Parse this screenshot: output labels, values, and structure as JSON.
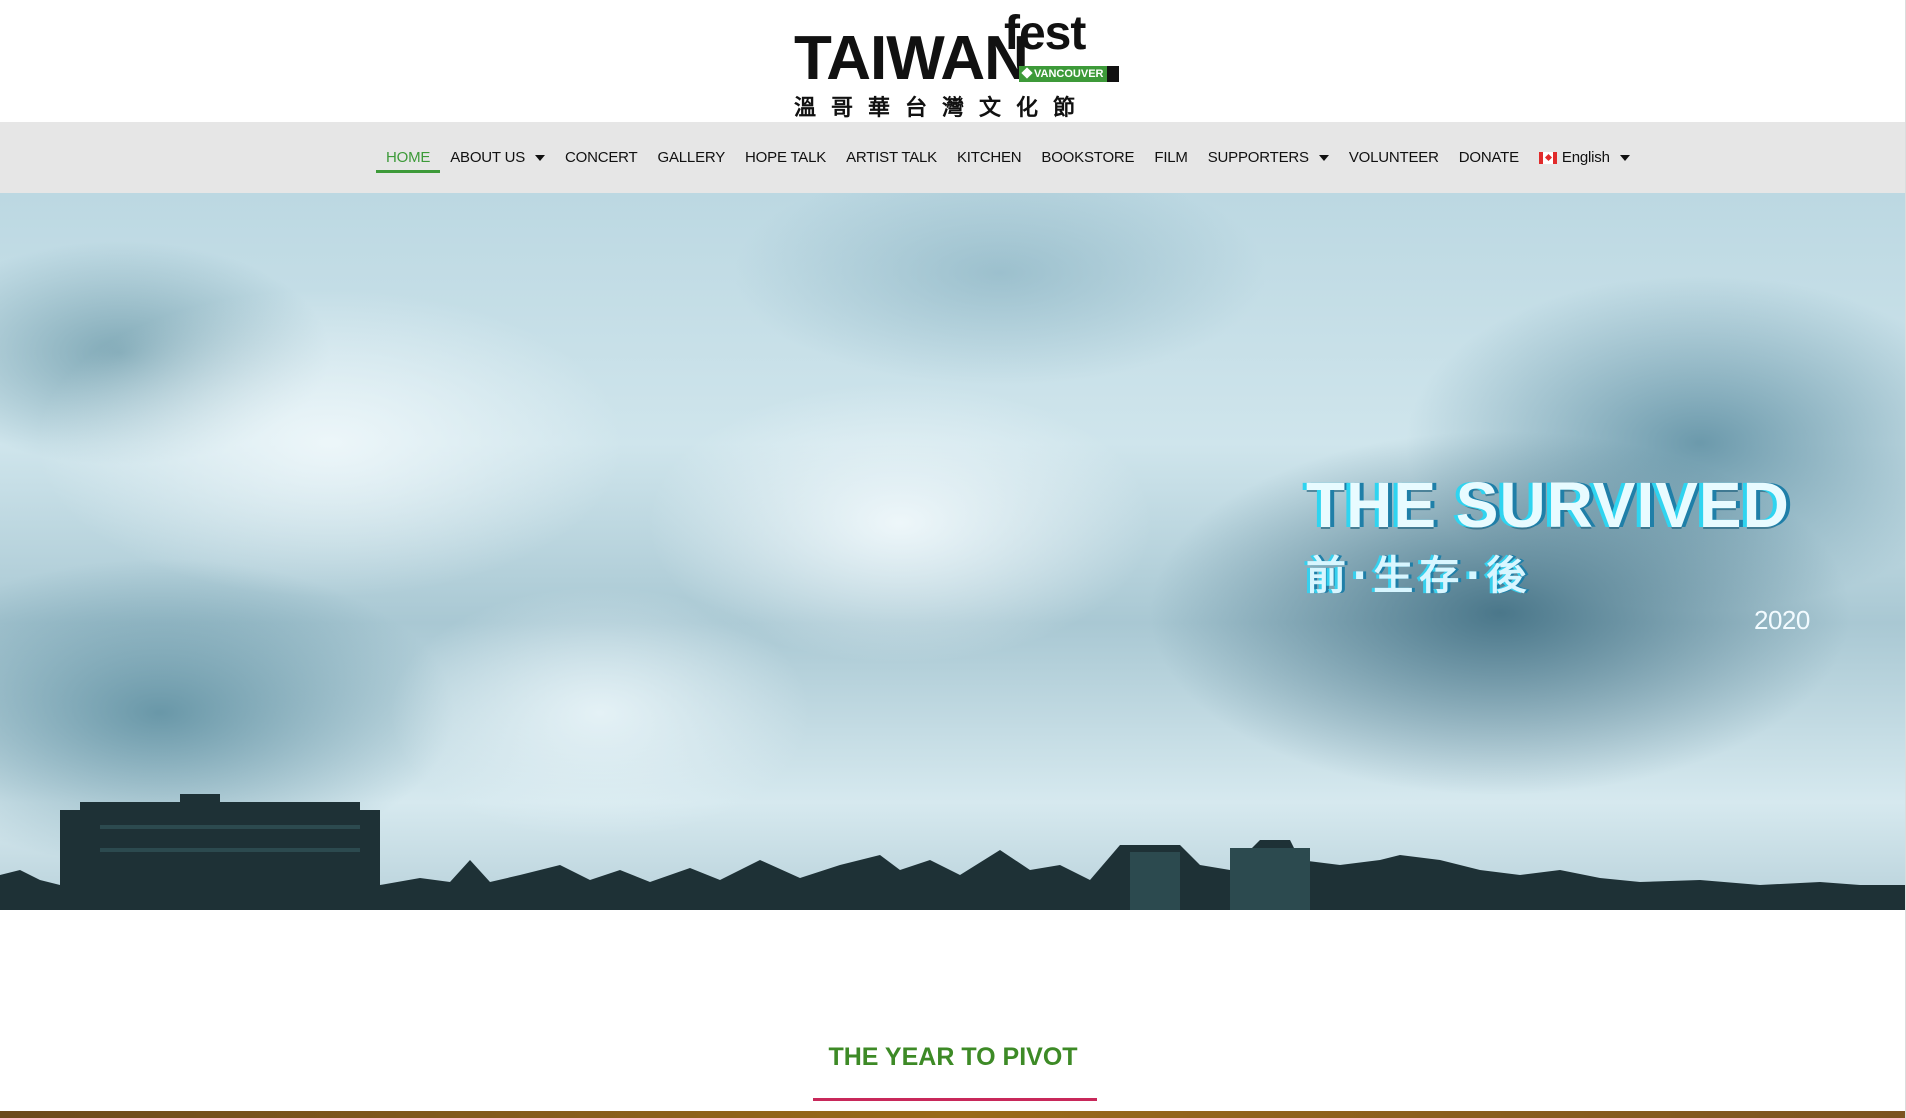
{
  "logo": {
    "main": "TAIWAN",
    "suffix": "fest",
    "badge": "VANCOUVER",
    "chinese": "溫哥華台灣文化節"
  },
  "nav": {
    "items": [
      {
        "label": "HOME",
        "active": true
      },
      {
        "label": "ABOUT US",
        "dropdown": true
      },
      {
        "label": "CONCERT"
      },
      {
        "label": "GALLERY"
      },
      {
        "label": "HOPE TALK"
      },
      {
        "label": "ARTIST TALK"
      },
      {
        "label": "KITCHEN"
      },
      {
        "label": "BOOKSTORE"
      },
      {
        "label": "FILM"
      },
      {
        "label": "SUPPORTERS",
        "dropdown": true
      },
      {
        "label": "VOLUNTEER"
      },
      {
        "label": "DONATE"
      }
    ],
    "language": {
      "label": "English",
      "flag": "canada-flag-icon"
    }
  },
  "hero": {
    "title": "THE SURVIVED",
    "subtitle": "前·生存·後",
    "year": "2020"
  },
  "section": {
    "title": "THE YEAR TO PIVOT"
  },
  "colors": {
    "accent_green": "#3d9a39",
    "underline_pink": "#c8285a",
    "nav_bg": "#e6e6e6"
  }
}
